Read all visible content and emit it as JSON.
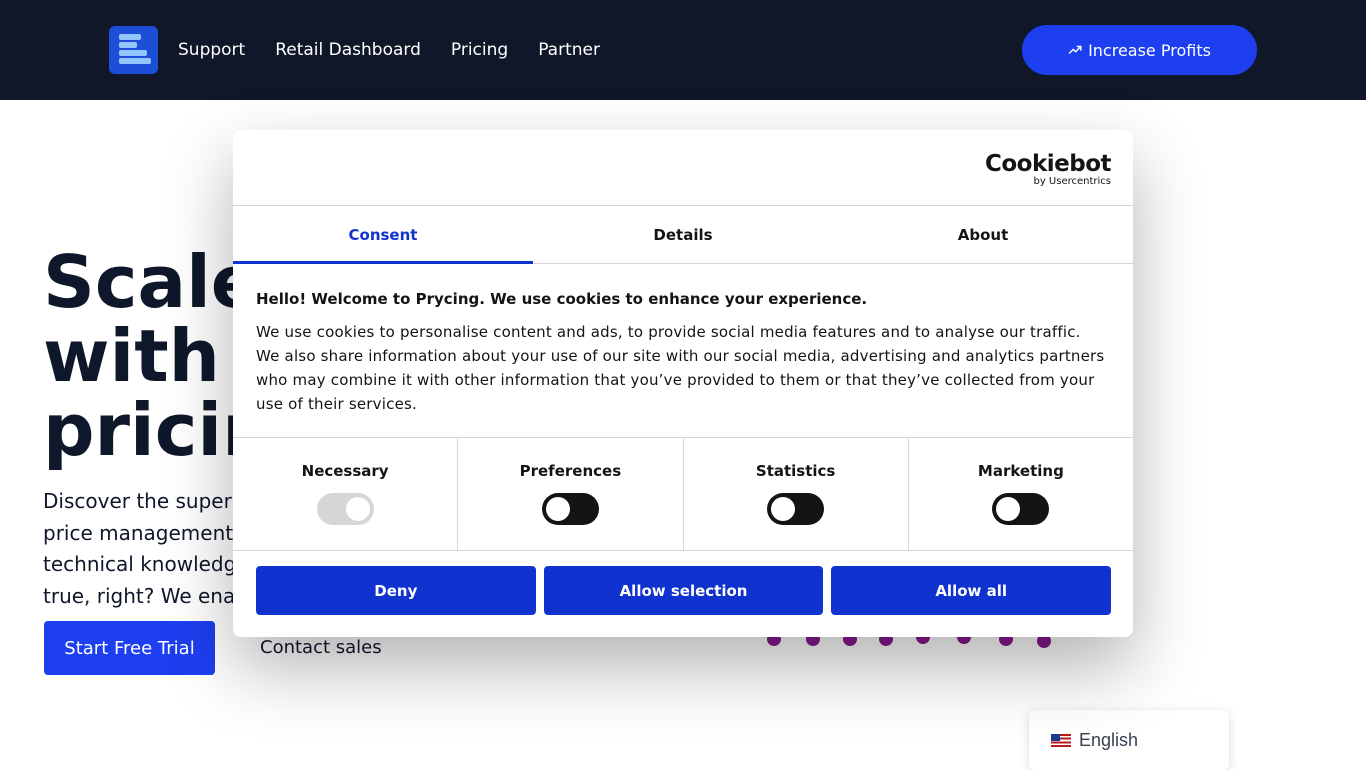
{
  "header": {
    "nav": [
      "Support",
      "Retail Dashboard",
      "Pricing",
      "Partner"
    ],
    "cta_label": "Increase Profits",
    "cta_icon": "trending-up-icon"
  },
  "hero": {
    "title_lines": [
      "Scale",
      "with s",
      "pricin"
    ],
    "subtitle_lines": [
      "Discover the superpo",
      "price management w",
      "technical knowledge",
      "true, right? We enabl"
    ],
    "trial_label": "Start Free Trial",
    "contact_label": "Contact sales"
  },
  "cookie": {
    "brand": "Cookiebot",
    "brand_sub": "by Usercentrics",
    "tabs": [
      "Consent",
      "Details",
      "About"
    ],
    "heading": "Hello! Welcome to Prycing. We use cookies to enhance your experience.",
    "body": "We use cookies to personalise content and ads, to provide social media features and to analyse our traffic. We also share information about your use of our site with our social media, advertising and analytics partners who may combine it with other information that you’ve provided to them or that they’ve collected from your use of their services.",
    "switches": [
      {
        "label": "Necessary",
        "state": "on-disabled"
      },
      {
        "label": "Preferences",
        "state": "off"
      },
      {
        "label": "Statistics",
        "state": "off"
      },
      {
        "label": "Marketing",
        "state": "off"
      }
    ],
    "buttons": [
      "Deny",
      "Allow selection",
      "Allow all"
    ],
    "accent": "#1032cf"
  },
  "language": {
    "label": "English",
    "flag": "us-flag-icon"
  },
  "colors": {
    "navbar": "#0f1729",
    "primary": "#1d3ff0",
    "dots": "#86198f"
  }
}
